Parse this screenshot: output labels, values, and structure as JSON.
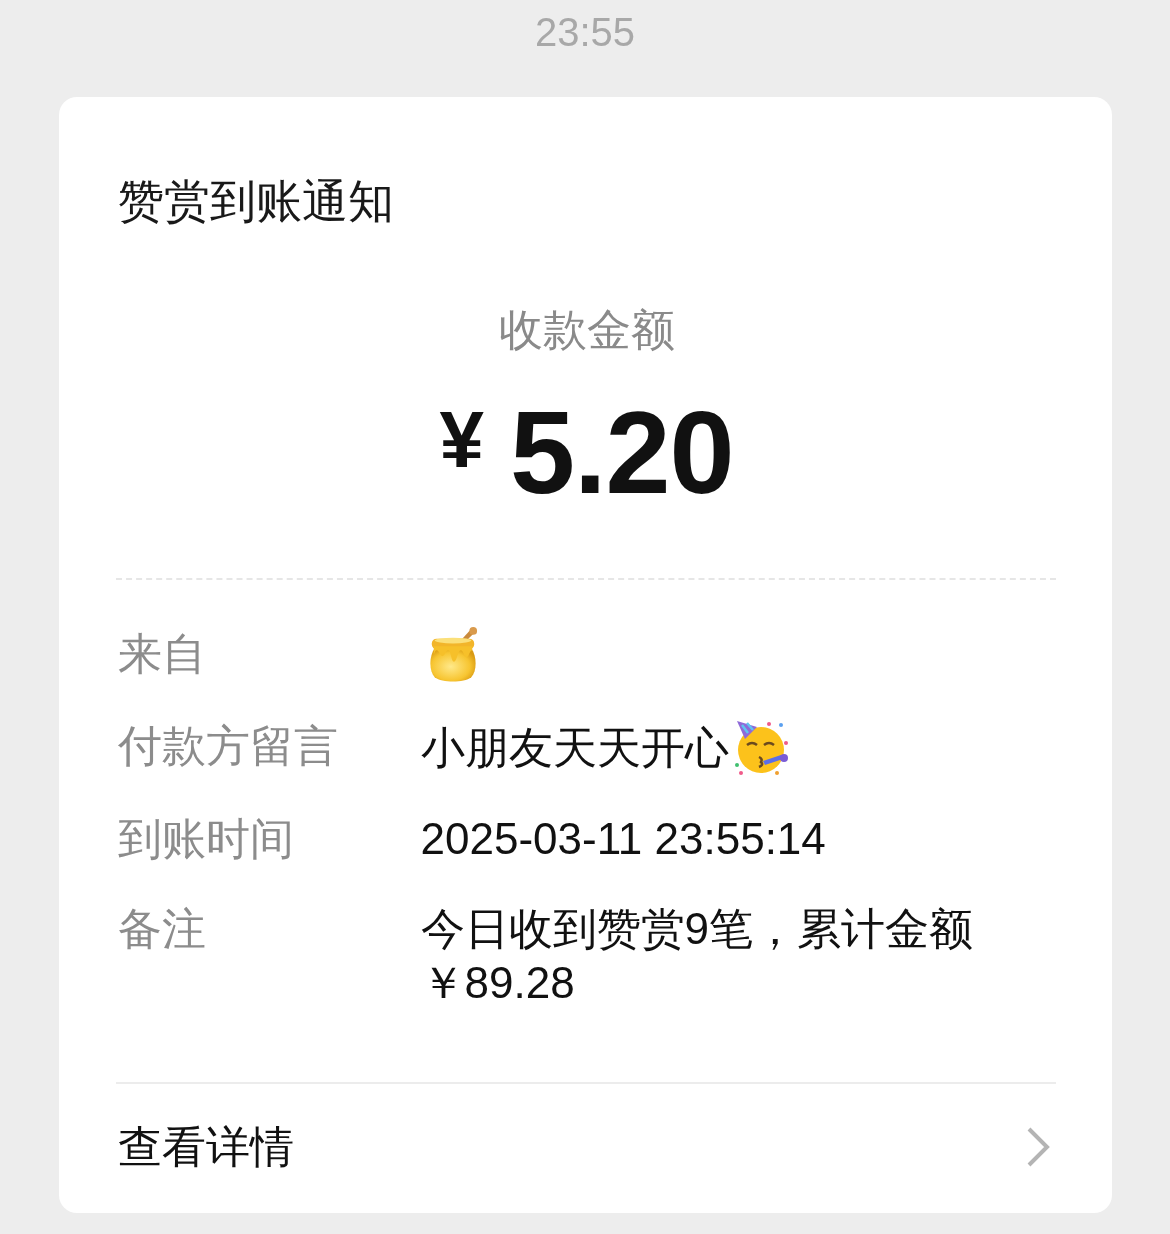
{
  "time": "23:55",
  "card": {
    "title": "赞赏到账通知",
    "amount_label": "收款金额",
    "amount": {
      "currency": "¥",
      "value": "5.20"
    },
    "details": [
      {
        "kind": "icon",
        "label": "来自"
      },
      {
        "kind": "text_icon",
        "label": "付款方留言",
        "value": "小朋友天天开心"
      },
      {
        "kind": "text",
        "label": "到账时间",
        "value": "2025-03-11 23:55:14"
      },
      {
        "kind": "text",
        "label": "备注",
        "value": "今日收到赞赏9笔，累计金额￥89.28"
      }
    ],
    "link": {
      "label": "查看详情"
    }
  }
}
